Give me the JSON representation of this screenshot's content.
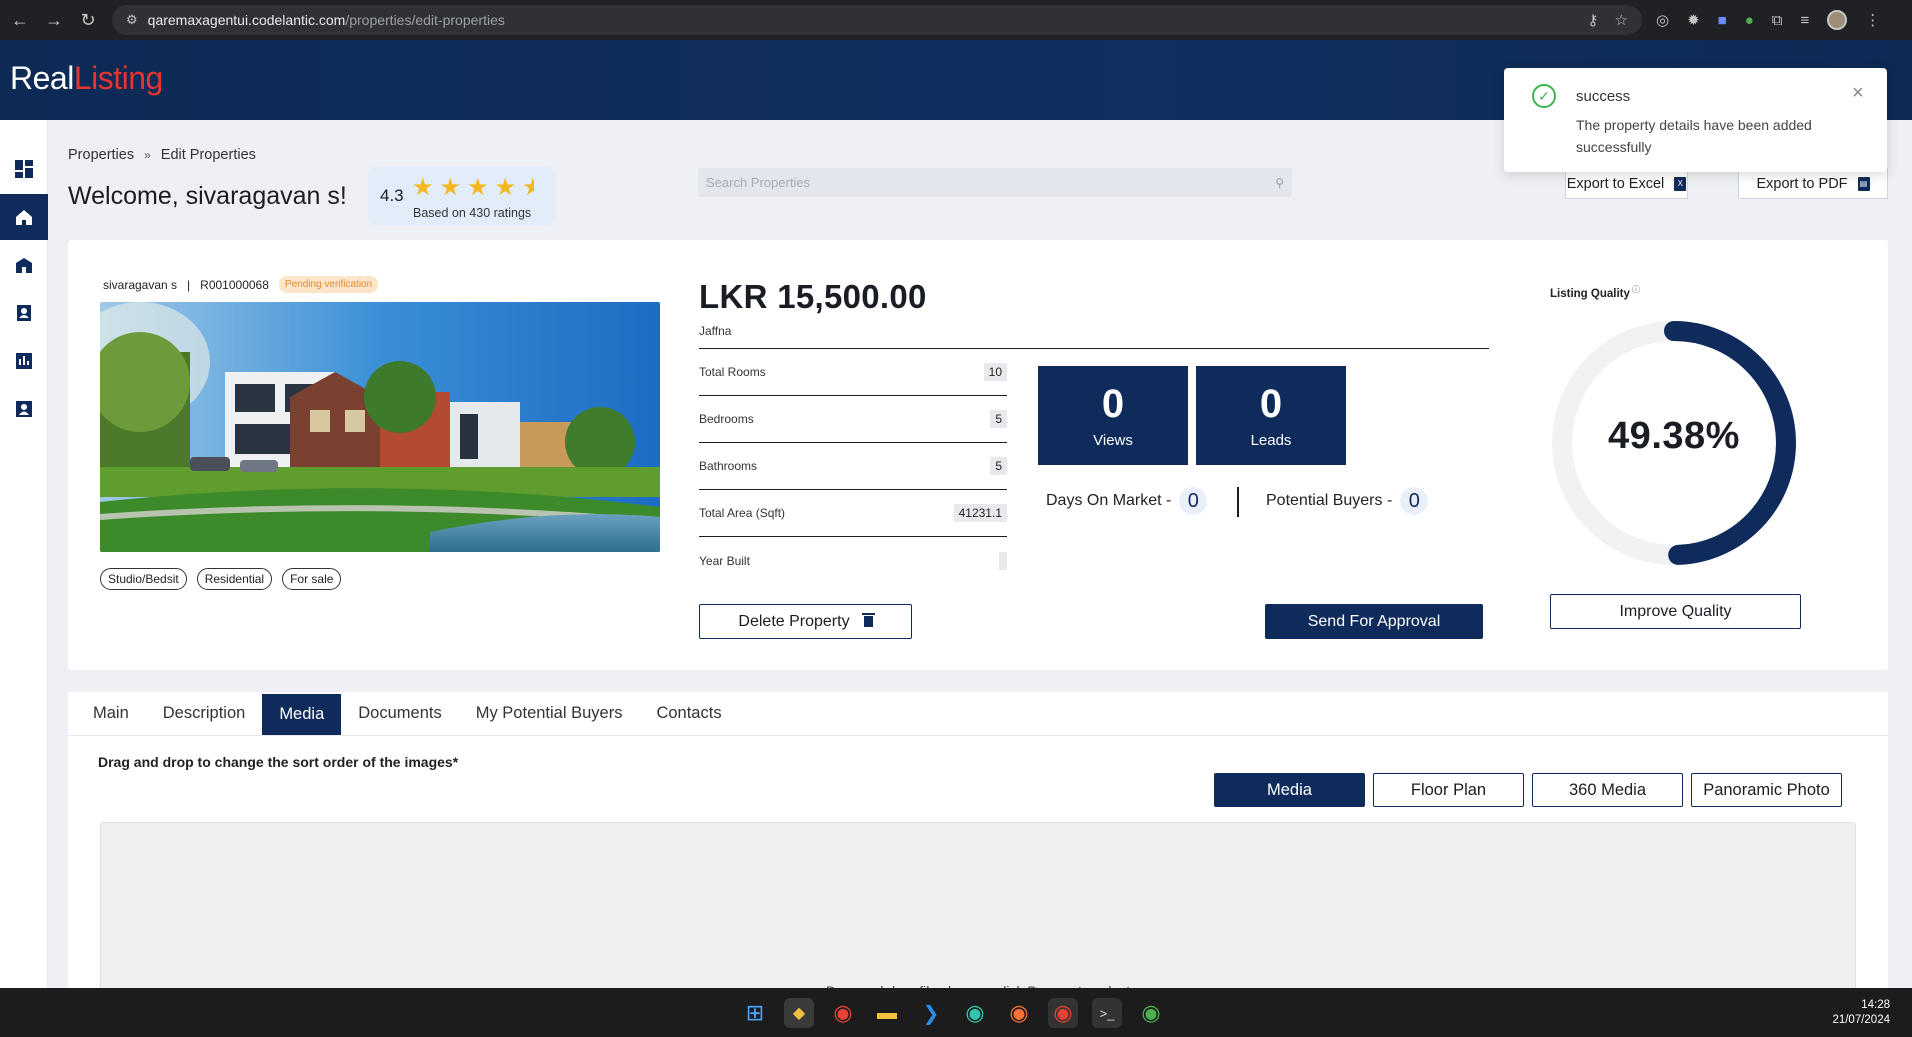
{
  "browser": {
    "url_host": "qaremaxagentui.codelantic.com",
    "url_path": "/properties/edit-properties"
  },
  "brand": {
    "part1": "Real",
    "part2": "Listing"
  },
  "breadcrumb": {
    "root": "Properties",
    "separator": "»",
    "current": "Edit Properties"
  },
  "welcome": "Welcome, sivaragavan s!",
  "rating": {
    "value": "4.3",
    "sub": "Based on 430 ratings",
    "stars": 4.5
  },
  "search": {
    "placeholder": "Search Properties"
  },
  "export": {
    "excel": "Export to Excel",
    "pdf": "Export to PDF"
  },
  "toast": {
    "title": "success",
    "message": "The property details have been added successfully"
  },
  "property": {
    "owner": "sivaragavan s",
    "divider": "|",
    "ref": "R001000068",
    "status": "Pending verification",
    "tags": [
      "Studio/Bedsit",
      "Residential",
      "For sale"
    ],
    "price": "LKR 15,500.00",
    "location": "Jaffna",
    "details": [
      {
        "label": "Total Rooms",
        "value": "10"
      },
      {
        "label": "Bedrooms",
        "value": "5"
      },
      {
        "label": "Bathrooms",
        "value": "5"
      },
      {
        "label": "Total Area (Sqft)",
        "value": "41231.1"
      },
      {
        "label": "Year Built",
        "value": ""
      }
    ],
    "views": {
      "value": "0",
      "label": "Views"
    },
    "leads": {
      "value": "0",
      "label": "Leads"
    },
    "days_on_market": {
      "label": "Days On Market -",
      "value": "0"
    },
    "potential_buyers": {
      "label": "Potential Buyers -",
      "value": "0"
    },
    "delete_label": "Delete Property",
    "approval_label": "Send For Approval",
    "listing_quality": {
      "label": "Listing Quality",
      "info": "ⓘ",
      "percent_text": "49.38%",
      "percent": 49.38,
      "improve_label": "Improve Quality"
    }
  },
  "tabs": [
    "Main",
    "Description",
    "Media",
    "Documents",
    "My Potential Buyers",
    "Contacts"
  ],
  "active_tab": "Media",
  "media": {
    "hint": "Drag and drop to change the sort order of the images*",
    "subtabs": [
      "Media",
      "Floor Plan",
      "360 Media",
      "Panoramic Photo"
    ],
    "dropzone_text": "Drag and drop files here or click Browse to select"
  },
  "taskbar": {
    "time": "14:28",
    "date": "21/07/2024"
  },
  "colors": {
    "navy": "#0f2b5b",
    "accent_red": "#e8342e",
    "success": "#3bb54a",
    "pending": "#e38b2c"
  }
}
